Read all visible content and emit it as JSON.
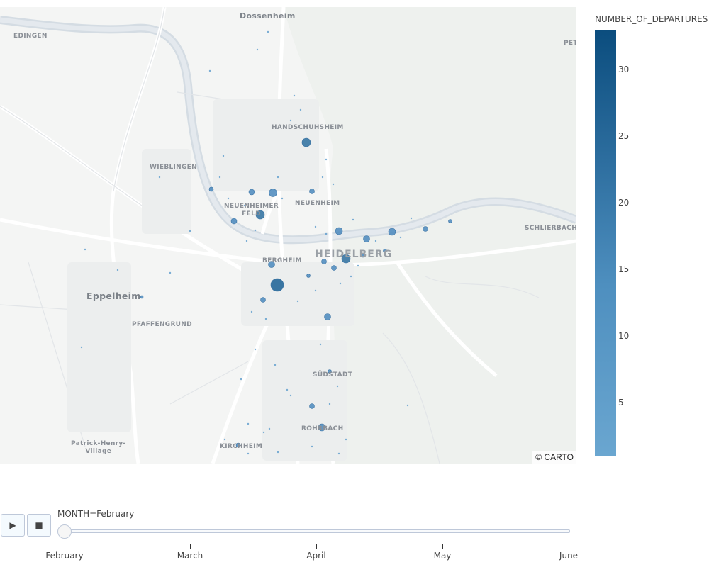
{
  "map": {
    "places": {
      "dossenheim": "Dossenheim",
      "edingen": "EDINGEN",
      "pet": "PET",
      "handschuhsheim": "HANDSCHUHSHEIM",
      "wieblingen": "WIEBLINGEN",
      "neuenheimer_feld_1": "NEUENHEIMER",
      "neuenheimer_feld_2": "FELD",
      "neuenheim": "NEUENHEIM",
      "schlierbach": "SCHLIERBACH",
      "heidelberg": "HEIDELBERG",
      "bergheim": "BERGHEIM",
      "eppelheim": "Eppelheim",
      "pfaffengrund": "PFAFFENGRUND",
      "suedstadt": "SÜDSTADT",
      "rohrbach": "ROHRBACH",
      "kirchheim": "KIRCHHEIM",
      "patrick_henry_1": "Patrick-Henry-",
      "patrick_henry_2": "Village"
    },
    "attribution": "© CARTO",
    "marker_color": "#4a88bd"
  },
  "colorbar": {
    "title": "NUMBER_OF_DEPARTURES",
    "ticks": [
      "30",
      "25",
      "20",
      "15",
      "10",
      "5"
    ],
    "range": [
      1,
      33
    ],
    "color_low": "#6aa6d0",
    "color_high": "#0b4d7e"
  },
  "controls": {
    "play_icon": "play-icon",
    "stop_icon": "stop-icon",
    "current_label": "MONTH=February",
    "steps": [
      "February",
      "March",
      "April",
      "May",
      "June"
    ],
    "active_step": "February"
  }
}
